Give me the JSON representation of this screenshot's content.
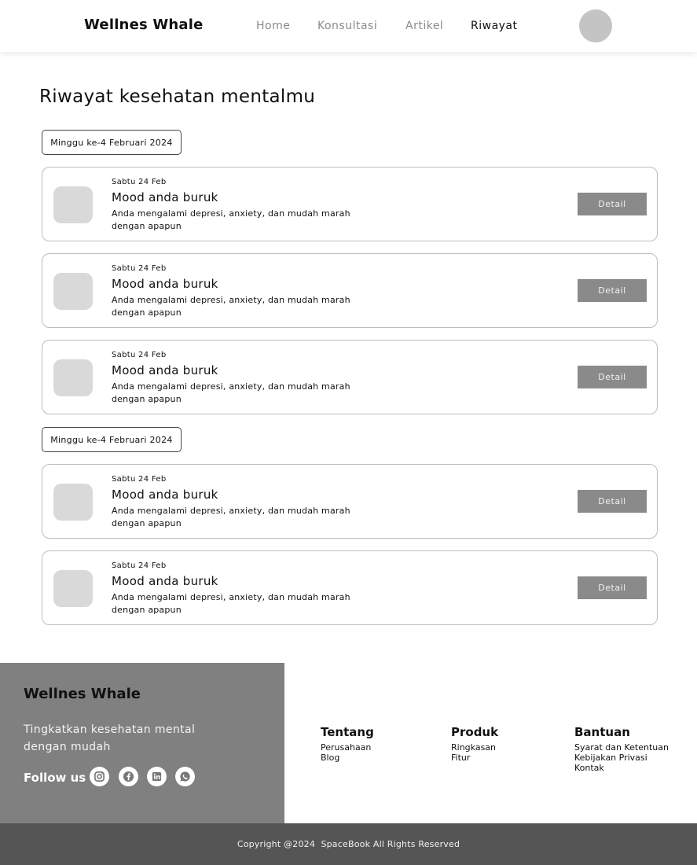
{
  "header": {
    "brand": "Wellnes Whale",
    "nav": [
      {
        "label": "Home",
        "active": false
      },
      {
        "label": "Konsultasi",
        "active": false
      },
      {
        "label": "Artikel",
        "active": false
      },
      {
        "label": "Riwayat",
        "active": true
      }
    ]
  },
  "main": {
    "title": "Riwayat kesehatan mentalmu",
    "groups": [
      {
        "week_label": "Minggu ke-4 Februari 2024",
        "entries": [
          {
            "date": "Sabtu 24 Feb",
            "title": "Mood anda buruk",
            "description": "Anda mengalami depresi, anxiety, dan mudah marah dengan apapun",
            "button": "Detail"
          },
          {
            "date": "Sabtu 24 Feb",
            "title": "Mood anda buruk",
            "description": "Anda mengalami depresi, anxiety, dan mudah marah dengan apapun",
            "button": "Detail"
          },
          {
            "date": "Sabtu 24 Feb",
            "title": "Mood anda buruk",
            "description": "Anda mengalami depresi, anxiety, dan mudah marah dengan apapun",
            "button": "Detail"
          }
        ]
      },
      {
        "week_label": "Minggu ke-4 Februari 2024",
        "entries": [
          {
            "date": "Sabtu 24 Feb",
            "title": "Mood anda buruk",
            "description": "Anda mengalami depresi, anxiety, dan mudah marah dengan apapun",
            "button": "Detail"
          },
          {
            "date": "Sabtu 24 Feb",
            "title": "Mood anda buruk",
            "description": "Anda mengalami depresi, anxiety, dan mudah marah dengan apapun",
            "button": "Detail"
          }
        ]
      }
    ]
  },
  "footer": {
    "brand": "Wellnes Whale",
    "tagline": "Tingkatkan kesehatan mental dengan mudah",
    "follow_label": "Follow us",
    "socials": [
      "instagram-icon",
      "facebook-icon",
      "linkedin-icon",
      "whatsapp-icon"
    ],
    "columns": [
      {
        "title": "Tentang",
        "links": [
          "Perusahaan",
          "Blog"
        ]
      },
      {
        "title": "Produk",
        "links": [
          "Ringkasan",
          "Fitur"
        ]
      },
      {
        "title": "Bantuan",
        "links": [
          "Syarat dan Ketentuan",
          "Kebijakan Privasi",
          "Kontak"
        ]
      }
    ],
    "copyright": "Copyright @2024  SpaceBook All Rights Reserved"
  },
  "colors": {
    "footer_left": "#808080",
    "copyright_bar": "#555555",
    "button": "#8a8a8a",
    "thumb": "#d9d9d9",
    "avatar": "#c4c4c4"
  }
}
